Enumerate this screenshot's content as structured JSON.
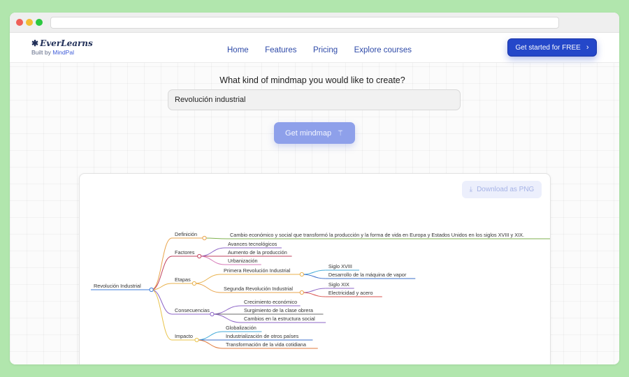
{
  "header": {
    "logo_title": "EverLearns",
    "logo_sub_prefix": "Built by",
    "logo_sub_brand": "MindPal",
    "nav": [
      "Home",
      "Features",
      "Pricing",
      "Explore courses"
    ],
    "cta_label": "Get started for FREE"
  },
  "form": {
    "prompt": "What kind of mindmap you would like to create?",
    "topic_value": "Revolución industrial",
    "submit_label": "Get mindmap"
  },
  "card": {
    "download_label": "Download as PNG"
  },
  "mindmap": {
    "root": "Revolución Industrial",
    "branches": [
      {
        "label": "Definición",
        "color": "#e9a44c",
        "children": [
          {
            "label": "Cambio económico y social que transformó la producción y la forma de vida en Europa y Estados Unidos en los siglos XVIII y XIX.",
            "color": "#7fb24f"
          }
        ]
      },
      {
        "label": "Factores",
        "color": "#c2425c",
        "children": [
          {
            "label": "Avances tecnológicos",
            "color": "#8e66c7"
          },
          {
            "label": "Aumento de la producción",
            "color": "#c2425c"
          },
          {
            "label": "Urbanización",
            "color": "#d77ab8"
          }
        ]
      },
      {
        "label": "Etapas",
        "color": "#e9b24c",
        "children": [
          {
            "label": "Primera Revolución Industrial",
            "color": "#e9b24c",
            "children": [
              {
                "label": "Siglo XVIII",
                "color": "#43aad8"
              },
              {
                "label": "Desarrollo de la máquina de vapor",
                "color": "#3b6fcb"
              }
            ]
          },
          {
            "label": "Segunda Revolución Industrial",
            "color": "#e9a44c",
            "children": [
              {
                "label": "Siglo XIX",
                "color": "#8e66c7"
              },
              {
                "label": "Electricidad y acero",
                "color": "#d9534f"
              }
            ]
          }
        ]
      },
      {
        "label": "Consecuencias",
        "color": "#8e66c7",
        "children": [
          {
            "label": "Crecimiento económico",
            "color": "#8e66c7"
          },
          {
            "label": "Surgimiento de la clase obrera",
            "color": "#6b6b6b"
          },
          {
            "label": "Cambios en la estructura social",
            "color": "#8e66c7"
          }
        ]
      },
      {
        "label": "Impacto",
        "color": "#e8c34a",
        "children": [
          {
            "label": "Globalización",
            "color": "#43aad8"
          },
          {
            "label": "Industrialización de otros países",
            "color": "#3b6fcb"
          },
          {
            "label": "Transformación de la vida cotidiana",
            "color": "#e07a3c"
          }
        ]
      }
    ],
    "root_color": "#3d7bd8"
  }
}
